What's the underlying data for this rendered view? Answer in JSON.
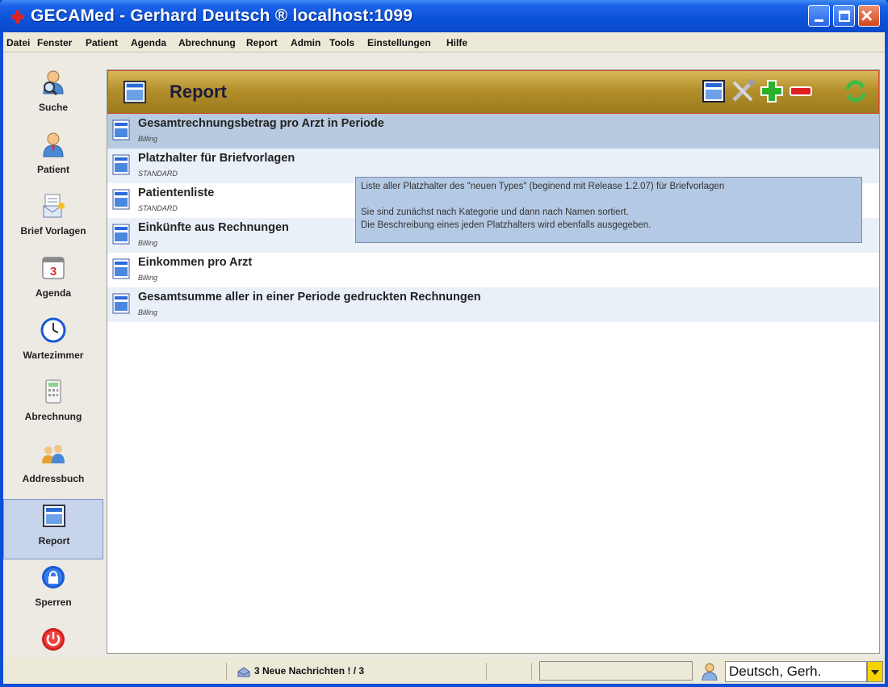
{
  "window": {
    "title": "GECAMed - Gerhard Deutsch ® localhost:1099"
  },
  "menu": [
    "Datei",
    "Fenster",
    "Patient",
    "Agenda",
    "Abrechnung",
    "Report",
    "Admin",
    "Tools",
    "Einstellungen",
    "Hilfe"
  ],
  "sidebar": {
    "items": [
      {
        "label": "Suche",
        "icon": "search-person-icon"
      },
      {
        "label": "Patient",
        "icon": "patient-icon"
      },
      {
        "label": "Brief Vorlagen",
        "icon": "letter-templates-icon"
      },
      {
        "label": "Agenda",
        "icon": "calendar-icon"
      },
      {
        "label": "Wartezimmer",
        "icon": "clock-icon"
      },
      {
        "label": "Abrechnung",
        "icon": "calculator-icon"
      },
      {
        "label": "Addressbuch",
        "icon": "address-book-icon"
      },
      {
        "label": "Report",
        "icon": "report-icon"
      },
      {
        "label": "Sperren",
        "icon": "lock-icon"
      },
      {
        "label": "",
        "icon": "power-icon"
      }
    ],
    "active_index": 7
  },
  "panel": {
    "title": "Report",
    "tools": [
      "report-icon",
      "settings-tools-icon",
      "add-icon",
      "remove-icon",
      "refresh-icon"
    ]
  },
  "reports": [
    {
      "title": "Gesamtrechnungsbetrag pro Arzt in Periode",
      "category": "Billing"
    },
    {
      "title": "Platzhalter für Briefvorlagen",
      "category": "STANDARD"
    },
    {
      "title": "Patientenliste",
      "category": "STANDARD"
    },
    {
      "title": "Einkünfte aus Rechnungen",
      "category": "Billing"
    },
    {
      "title": "Einkommen pro Arzt",
      "category": "Billing"
    },
    {
      "title": "Gesamtsumme aller in einer Periode gedruckten Rechnungen",
      "category": "Billing"
    }
  ],
  "tooltip": {
    "line1": "Liste aller Platzhalter des \"neuen Types\" (beginend mit Release 1.2.07) für Briefvorlagen",
    "line2": "Sie sind zunächst nach Kategorie und dann nach Namen sortiert.",
    "line3": "Die Beschreibung eines jeden Platzhalters wird ebenfalls ausgegeben."
  },
  "statusbar": {
    "messages": "3 Neue Nachrichten ! / 3",
    "user": "Deutsch, Gerh."
  },
  "colors": {
    "titlebar": "#0a52d9",
    "panel_header": "#b4902c",
    "selected_row": "#b8cae0",
    "tooltip": "#b4cae4"
  }
}
